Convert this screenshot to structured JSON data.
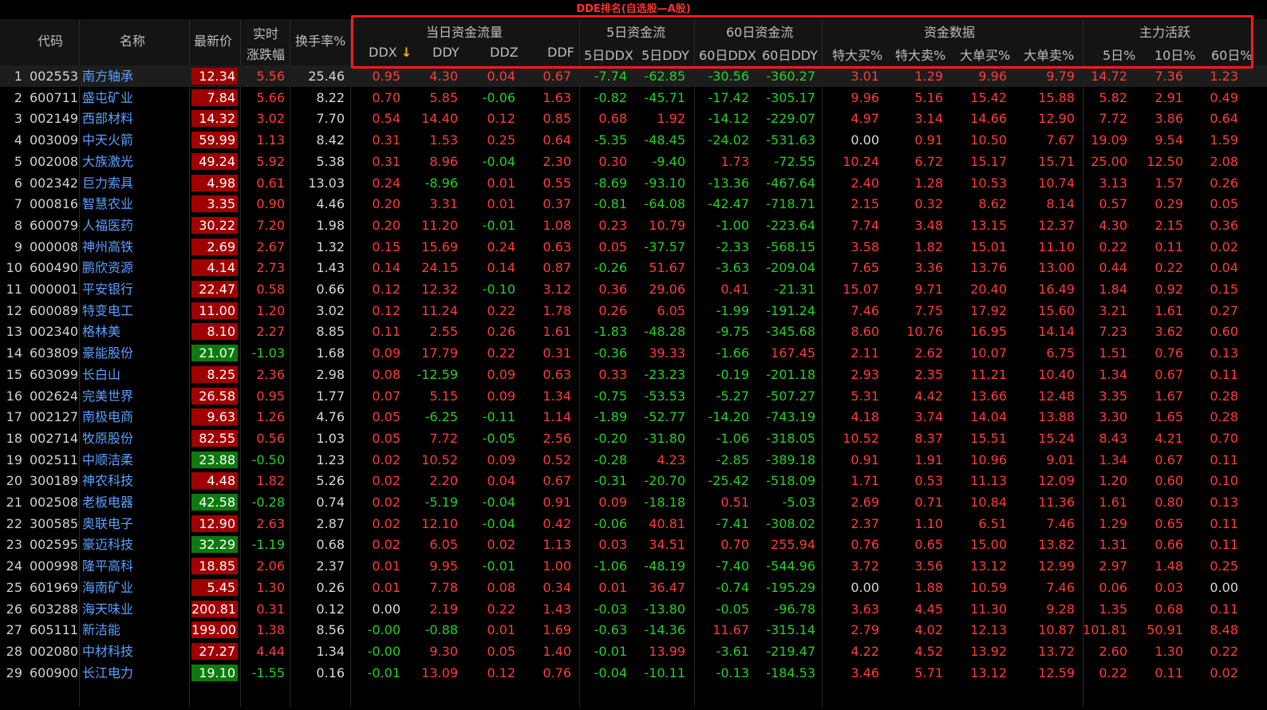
{
  "title": "DDE排名(自选股—A股)",
  "colors": {
    "up": "#ff3b3b",
    "down": "#25d025",
    "flat": "#d8d8d8",
    "highlight_box": "#ff1a1a"
  },
  "header": {
    "code": "代码",
    "name": "名称",
    "price": "最新价",
    "change_top": "实时",
    "change_bottom": "涨跌幅",
    "turnover": "换手率%",
    "group_today": "当日资金流量",
    "group_5d": "5日资金流",
    "group_60d": "60日资金流",
    "group_fund": "资金数据",
    "group_active": "主力活跃",
    "ddx": "DDX",
    "sort_arrow": "↓",
    "ddy": "DDY",
    "ddz": "DDZ",
    "ddf": "DDF",
    "ddx5": "5日DDX",
    "ddy5": "5日DDY",
    "ddx60": "60日DDX",
    "ddy60": "60日DDY",
    "tdb": "特大买%",
    "tds": "特大卖%",
    "ddb": "大单买%",
    "dds": "大单卖%",
    "a5": "5日%",
    "a10": "10日%",
    "a60": "60日%"
  },
  "rows": [
    [
      "1",
      "002553",
      "南方轴承",
      "12.34",
      "5.56",
      "25.46",
      "0.95",
      "4.30",
      "0.04",
      "0.67",
      "-7.74",
      "-62.85",
      "-30.56",
      "-360.27",
      "3.01",
      "1.29",
      "9.96",
      "9.79",
      "14.72",
      "7.36",
      "1.23"
    ],
    [
      "2",
      "600711",
      "盛屯矿业",
      "7.84",
      "5.66",
      "8.22",
      "0.70",
      "5.85",
      "-0.06",
      "1.63",
      "-0.82",
      "-45.71",
      "-17.42",
      "-305.17",
      "9.96",
      "5.16",
      "15.42",
      "15.88",
      "5.82",
      "2.91",
      "0.49"
    ],
    [
      "3",
      "002149",
      "西部材料",
      "14.32",
      "3.02",
      "7.70",
      "0.54",
      "14.40",
      "0.12",
      "0.85",
      "0.68",
      "1.92",
      "-14.12",
      "-229.07",
      "4.97",
      "3.14",
      "14.66",
      "12.90",
      "7.72",
      "3.86",
      "0.64"
    ],
    [
      "4",
      "003009",
      "中天火箭",
      "59.99",
      "1.13",
      "8.42",
      "0.31",
      "1.53",
      "0.25",
      "0.64",
      "-5.35",
      "-48.45",
      "-24.02",
      "-531.63",
      "0.00",
      "0.91",
      "10.50",
      "7.67",
      "19.09",
      "9.54",
      "1.59"
    ],
    [
      "5",
      "002008",
      "大族激光",
      "49.24",
      "5.92",
      "5.38",
      "0.31",
      "8.96",
      "-0.04",
      "2.30",
      "0.30",
      "-9.40",
      "1.73",
      "-72.55",
      "10.24",
      "6.72",
      "15.17",
      "15.71",
      "25.00",
      "12.50",
      "2.08"
    ],
    [
      "6",
      "002342",
      "巨力索具",
      "4.98",
      "0.61",
      "13.03",
      "0.24",
      "-8.96",
      "0.01",
      "0.55",
      "-8.69",
      "-93.10",
      "-13.36",
      "-467.64",
      "2.40",
      "1.28",
      "10.53",
      "10.74",
      "3.13",
      "1.57",
      "0.26"
    ],
    [
      "7",
      "000816",
      "智慧农业",
      "3.35",
      "0.90",
      "4.46",
      "0.20",
      "3.31",
      "0.01",
      "0.37",
      "-0.81",
      "-64.08",
      "-42.47",
      "-718.71",
      "2.15",
      "0.32",
      "8.62",
      "8.14",
      "0.57",
      "0.29",
      "0.05"
    ],
    [
      "8",
      "600079",
      "人福医药",
      "30.22",
      "7.20",
      "1.98",
      "0.20",
      "11.20",
      "-0.01",
      "1.08",
      "0.23",
      "10.79",
      "-1.00",
      "-223.64",
      "7.74",
      "3.48",
      "13.15",
      "12.37",
      "4.30",
      "2.15",
      "0.36"
    ],
    [
      "9",
      "000008",
      "神州高铁",
      "2.69",
      "2.67",
      "1.32",
      "0.15",
      "15.69",
      "0.24",
      "0.63",
      "0.05",
      "-37.57",
      "-2.33",
      "-568.15",
      "3.58",
      "1.82",
      "15.01",
      "11.10",
      "0.22",
      "0.11",
      "0.02"
    ],
    [
      "10",
      "600490",
      "鹏欣资源",
      "4.14",
      "2.73",
      "1.43",
      "0.14",
      "24.15",
      "0.14",
      "0.87",
      "-0.26",
      "51.67",
      "-3.63",
      "-209.04",
      "7.65",
      "3.36",
      "13.76",
      "13.00",
      "0.44",
      "0.22",
      "0.04"
    ],
    [
      "11",
      "000001",
      "平安银行",
      "22.47",
      "0.58",
      "0.66",
      "0.12",
      "12.32",
      "-0.10",
      "3.12",
      "0.36",
      "29.06",
      "0.41",
      "-21.31",
      "15.07",
      "9.71",
      "20.40",
      "16.49",
      "1.84",
      "0.92",
      "0.15"
    ],
    [
      "12",
      "600089",
      "特变电工",
      "11.00",
      "1.20",
      "3.02",
      "0.12",
      "11.24",
      "0.22",
      "1.78",
      "0.26",
      "6.05",
      "-1.99",
      "-191.24",
      "7.46",
      "7.75",
      "17.92",
      "15.60",
      "3.21",
      "1.61",
      "0.27"
    ],
    [
      "13",
      "002340",
      "格林美",
      "8.10",
      "2.27",
      "8.85",
      "0.11",
      "2.55",
      "0.26",
      "1.61",
      "-1.83",
      "-48.28",
      "-9.75",
      "-345.68",
      "8.60",
      "10.76",
      "16.95",
      "14.14",
      "7.23",
      "3.62",
      "0.60"
    ],
    [
      "14",
      "603809",
      "豪能股份",
      "21.07",
      "-1.03",
      "1.68",
      "0.09",
      "17.79",
      "0.22",
      "0.31",
      "-0.36",
      "39.33",
      "-1.66",
      "167.45",
      "2.11",
      "2.62",
      "10.07",
      "6.75",
      "1.51",
      "0.76",
      "0.13"
    ],
    [
      "15",
      "603099",
      "长白山",
      "8.25",
      "2.36",
      "2.98",
      "0.08",
      "-12.59",
      "0.09",
      "0.63",
      "0.33",
      "-23.23",
      "-0.19",
      "-201.18",
      "2.93",
      "2.35",
      "11.21",
      "10.40",
      "1.34",
      "0.67",
      "0.11"
    ],
    [
      "16",
      "002624",
      "完美世界",
      "26.58",
      "0.95",
      "1.77",
      "0.07",
      "5.15",
      "0.09",
      "1.34",
      "-0.75",
      "-53.53",
      "-5.27",
      "-507.27",
      "5.31",
      "4.42",
      "13.66",
      "12.48",
      "3.35",
      "1.67",
      "0.28"
    ],
    [
      "17",
      "002127",
      "南极电商",
      "9.63",
      "1.26",
      "4.76",
      "0.05",
      "-6.25",
      "-0.11",
      "1.14",
      "-1.89",
      "-52.77",
      "-14.20",
      "-743.19",
      "4.18",
      "3.74",
      "14.04",
      "13.88",
      "3.30",
      "1.65",
      "0.28"
    ],
    [
      "18",
      "002714",
      "牧原股份",
      "82.55",
      "0.56",
      "1.03",
      "0.05",
      "7.72",
      "-0.05",
      "2.56",
      "-0.20",
      "-31.80",
      "-1.06",
      "-318.05",
      "10.52",
      "8.37",
      "15.51",
      "15.24",
      "8.43",
      "4.21",
      "0.70"
    ],
    [
      "19",
      "002511",
      "中顺洁柔",
      "23.88",
      "-0.50",
      "1.23",
      "0.02",
      "10.52",
      "0.09",
      "0.52",
      "-0.28",
      "4.23",
      "-2.85",
      "-389.18",
      "0.91",
      "1.91",
      "10.96",
      "9.01",
      "1.34",
      "0.67",
      "0.11"
    ],
    [
      "20",
      "300189",
      "神农科技",
      "4.48",
      "1.82",
      "5.26",
      "0.02",
      "2.20",
      "0.04",
      "0.67",
      "-0.31",
      "-20.70",
      "-25.42",
      "-518.09",
      "1.71",
      "0.53",
      "11.13",
      "12.09",
      "1.20",
      "0.60",
      "0.10"
    ],
    [
      "21",
      "002508",
      "老板电器",
      "42.58",
      "-0.28",
      "0.74",
      "0.02",
      "-5.19",
      "-0.04",
      "0.91",
      "0.09",
      "-18.18",
      "0.51",
      "-5.03",
      "2.69",
      "0.71",
      "10.84",
      "11.36",
      "1.61",
      "0.80",
      "0.13"
    ],
    [
      "22",
      "300585",
      "奥联电子",
      "12.90",
      "2.63",
      "2.87",
      "0.02",
      "12.10",
      "-0.04",
      "0.42",
      "-0.06",
      "40.81",
      "-7.41",
      "-308.02",
      "2.37",
      "1.10",
      "6.51",
      "7.46",
      "1.29",
      "0.65",
      "0.11"
    ],
    [
      "23",
      "002595",
      "豪迈科技",
      "32.29",
      "-1.19",
      "0.68",
      "0.02",
      "6.05",
      "0.02",
      "1.13",
      "0.03",
      "34.51",
      "0.70",
      "255.94",
      "0.76",
      "0.65",
      "15.00",
      "13.82",
      "1.31",
      "0.66",
      "0.11"
    ],
    [
      "24",
      "000998",
      "隆平高科",
      "18.85",
      "2.06",
      "2.37",
      "0.01",
      "9.95",
      "-0.01",
      "1.00",
      "-1.06",
      "-48.19",
      "-7.40",
      "-544.96",
      "3.72",
      "3.56",
      "13.12",
      "12.99",
      "2.97",
      "1.48",
      "0.25"
    ],
    [
      "25",
      "601969",
      "海南矿业",
      "5.45",
      "1.30",
      "0.26",
      "0.01",
      "7.78",
      "0.08",
      "0.34",
      "0.01",
      "36.47",
      "-0.74",
      "-195.29",
      "0.00",
      "1.88",
      "10.59",
      "7.46",
      "0.06",
      "0.03",
      "0.00"
    ],
    [
      "26",
      "603288",
      "海天味业",
      "200.81",
      "0.31",
      "0.12",
      "0.00",
      "2.19",
      "0.22",
      "1.43",
      "-0.03",
      "-13.80",
      "-0.05",
      "-96.78",
      "3.63",
      "4.45",
      "11.30",
      "9.28",
      "1.35",
      "0.68",
      "0.11"
    ],
    [
      "27",
      "605111",
      "新洁能",
      "199.00",
      "1.38",
      "8.56",
      "-0.00",
      "-0.88",
      "0.01",
      "1.69",
      "-0.63",
      "-14.36",
      "11.67",
      "-315.14",
      "2.79",
      "4.02",
      "12.13",
      "10.87",
      "101.81",
      "50.91",
      "8.48"
    ],
    [
      "28",
      "002080",
      "中材科技",
      "27.27",
      "4.44",
      "1.34",
      "-0.00",
      "9.30",
      "0.05",
      "1.40",
      "-0.01",
      "13.99",
      "-3.61",
      "-219.47",
      "4.22",
      "4.52",
      "13.92",
      "13.72",
      "2.60",
      "1.30",
      "0.22"
    ],
    [
      "29",
      "600900",
      "长江电力",
      "19.10",
      "-1.55",
      "0.16",
      "-0.01",
      "13.09",
      "0.12",
      "0.76",
      "-0.04",
      "-10.11",
      "-0.13",
      "-184.53",
      "3.46",
      "5.71",
      "13.12",
      "12.59",
      "0.22",
      "0.11",
      "0.02"
    ]
  ]
}
